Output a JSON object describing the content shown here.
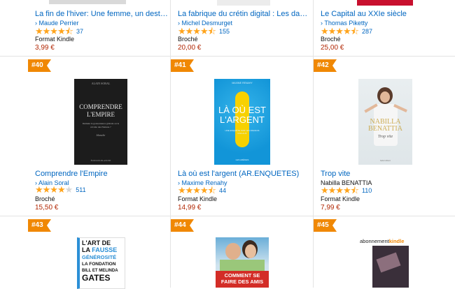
{
  "colors": {
    "badge": "#f08804",
    "link": "#0066c0",
    "price": "#b12704",
    "star": "#ffa41c"
  },
  "rows": [
    [
      {
        "rank": "",
        "title": "La fin de l'hiver: Une femme, un destin - Manon",
        "author": "Maude Perrier",
        "author_link": true,
        "rating": 4.5,
        "reviews": "37",
        "format": "Format Kindle",
        "price": "3,99 €"
      },
      {
        "rank": "",
        "title": "La fabrique du crétin digital : Les dangers des...",
        "author": "Michel Desmurget",
        "author_link": true,
        "rating": 4.5,
        "reviews": "155",
        "format": "Broché",
        "price": "20,00 €"
      },
      {
        "rank": "",
        "title": "Le Capital au XXIe siècle",
        "author": "Thomas Piketty",
        "author_link": true,
        "rating": 4.5,
        "reviews": "287",
        "format": "Broché",
        "price": "25,00 €"
      }
    ],
    [
      {
        "rank": "#40",
        "title": "Comprendre l'Empire",
        "author": "Alain Soral",
        "author_link": true,
        "rating": 4.0,
        "reviews": "511",
        "format": "Broché",
        "price": "15,50 €",
        "cover": {
          "top_text": "ALAIN SORAL",
          "main_title": "COMPRENDRE L'EMPIRE",
          "subtitle": "Demain la gouvernance globale ou la révolte des Nations ?",
          "brand": "blanche",
          "bottom": "ÉDITIONS BLANCHE"
        }
      },
      {
        "rank": "#41",
        "title": "Là où est l'argent (AR.ENQUETES)",
        "author": "Maxime Renahy",
        "author_link": true,
        "rating": 4.5,
        "reviews": "44",
        "format": "Format Kindle",
        "price": "14,99 €",
        "cover": {
          "top_text": "MAXIME RENAHY",
          "main_title": "LÀ OÙ EST L'ARGENT",
          "subtitle": "UNE ENQUÊTE SUR LES PARADIS FISCAUX",
          "bottom": "LES ARÈNES"
        }
      },
      {
        "rank": "#42",
        "title": "Trop vite",
        "author": "Nabilla BENATTIA",
        "author_link": false,
        "rating": 4.5,
        "reviews": "110",
        "format": "Format Kindle",
        "price": "7,99 €",
        "cover": {
          "top_text": "NABILLA",
          "main_title": "BENATTIA",
          "subtitle": "Trop vite",
          "bottom": "MAX MILO"
        }
      }
    ],
    [
      {
        "rank": "#43",
        "cover": {
          "lines": [
            "L'ART DE",
            "LA",
            "FAUSSE",
            "GÉNÉROSITÉ",
            "LA FONDATION",
            "BILL ET MELINDA",
            "GATES"
          ]
        }
      },
      {
        "rank": "#44",
        "cover": {
          "lines": [
            "COMMENT SE",
            "FAIRE DES AMIS"
          ]
        }
      },
      {
        "rank": "#45",
        "cover": {
          "lines": [
            "abonnement",
            "kindle"
          ]
        }
      }
    ]
  ]
}
